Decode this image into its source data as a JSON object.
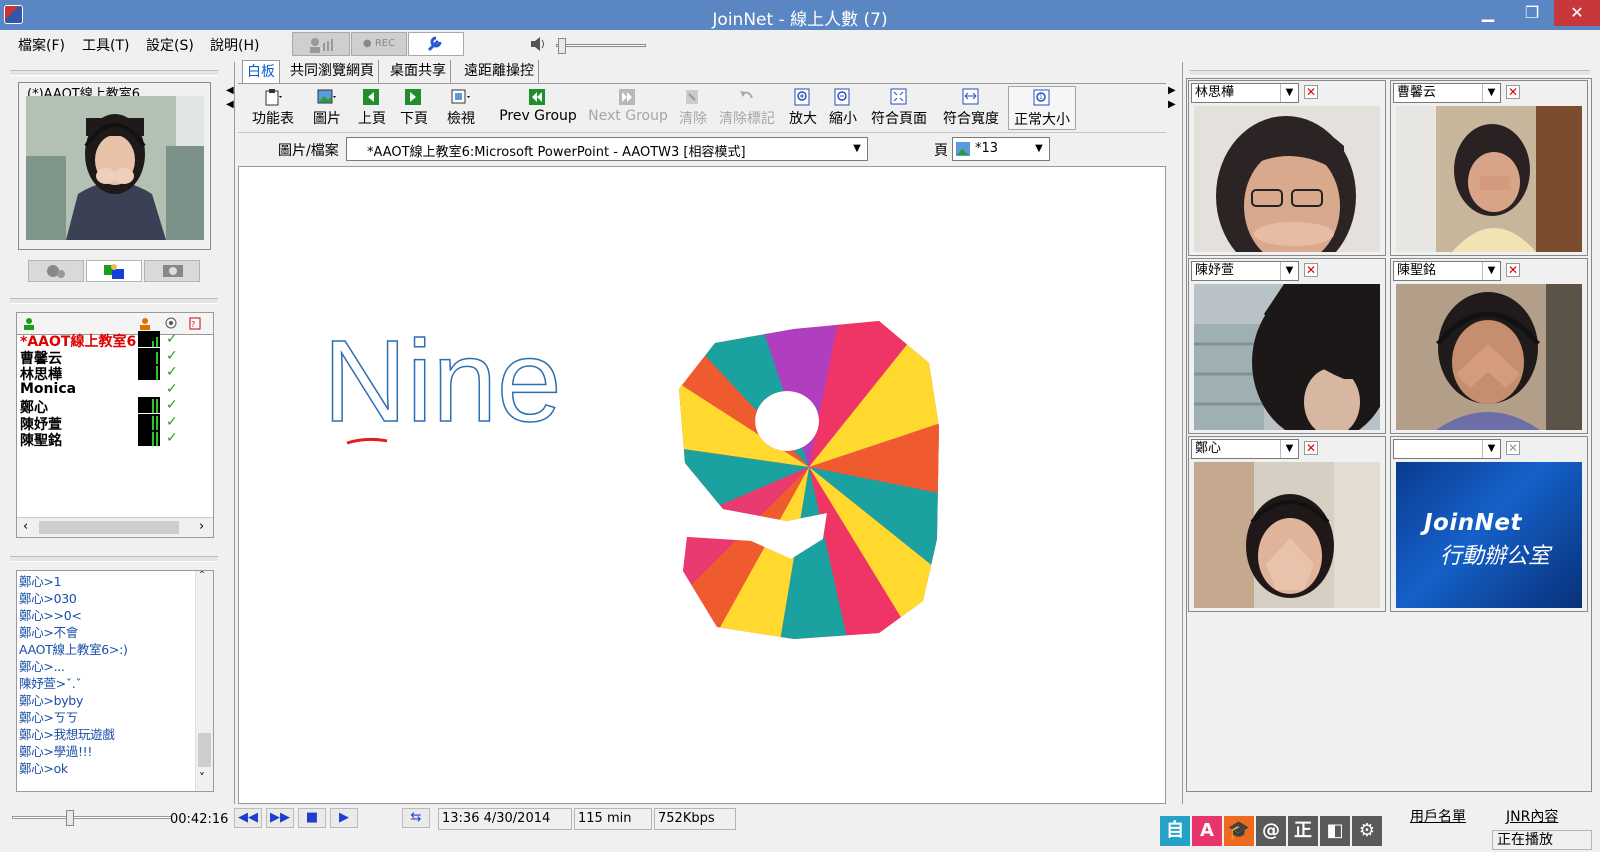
{
  "window": {
    "title": "JoinNet - 線上人數 (7)"
  },
  "menu": [
    "檔案(F)",
    "工具(T)",
    "設定(S)",
    "說明(H)"
  ],
  "toolbar": {
    "rec_label": "● REC"
  },
  "left_panel": {
    "room_title": "(*)AAOT線上教室6",
    "users": [
      {
        "name": "*AAOT線上教室6",
        "highlight": true
      },
      {
        "name": "曹馨云"
      },
      {
        "name": "林思樺"
      },
      {
        "name": "Monica"
      },
      {
        "name": "鄭心"
      },
      {
        "name": "陳妤萱"
      },
      {
        "name": "陳聖銘"
      }
    ],
    "chat": [
      "鄭心>1",
      "鄭心>030",
      "鄭心>>0<",
      "鄭心>不會",
      "AAOT線上教室6>:)",
      "鄭心>...",
      "陳妤萱>ˇ.ˇ",
      "鄭心>byby",
      "鄭心>ㄎㄎ",
      "鄭心>我想玩遊戲",
      "鄭心>學過!!!",
      "鄭心>ok"
    ]
  },
  "tabs": [
    "白板",
    "共同瀏覽網頁",
    "桌面共享",
    "遠距離操控"
  ],
  "tools": [
    "功能表",
    "圖片",
    "上頁",
    "下頁",
    "檢視",
    "Prev Group",
    "Next Group",
    "清除",
    "清除標記",
    "放大",
    "縮小",
    "符合頁面",
    "符合寬度",
    "正常大小"
  ],
  "file_bar": {
    "label": "圖片/檔案",
    "file": "*AAOT線上教室6:Microsoft PowerPoint - AAOTW3 [相容模式]",
    "page_label": "頁",
    "page": "*13"
  },
  "slide": {
    "word": "Nine",
    "digit": "9"
  },
  "video_panels": [
    {
      "name": "林思樺"
    },
    {
      "name": "曹馨云"
    },
    {
      "name": "陳妤萱"
    },
    {
      "name": "陳聖銘"
    },
    {
      "name": "鄭心"
    },
    {
      "name": ""
    }
  ],
  "logo": {
    "brand": "JoinNet",
    "subtitle": "行動辦公室"
  },
  "status_bar": {
    "elapsed": "00:42:16",
    "datetime": "13:36 4/30/2014",
    "duration": "115 min",
    "bitrate": "752Kbps",
    "user_list_link": "用戶名單",
    "jnr_link": "JNR內容",
    "state": "正在播放"
  },
  "ime_bar": [
    "自",
    "A",
    "@",
    "正"
  ],
  "colors": {
    "titlebar": "#5a86c4",
    "accent": "#1060d0",
    "chat": "#1a4fa8"
  }
}
